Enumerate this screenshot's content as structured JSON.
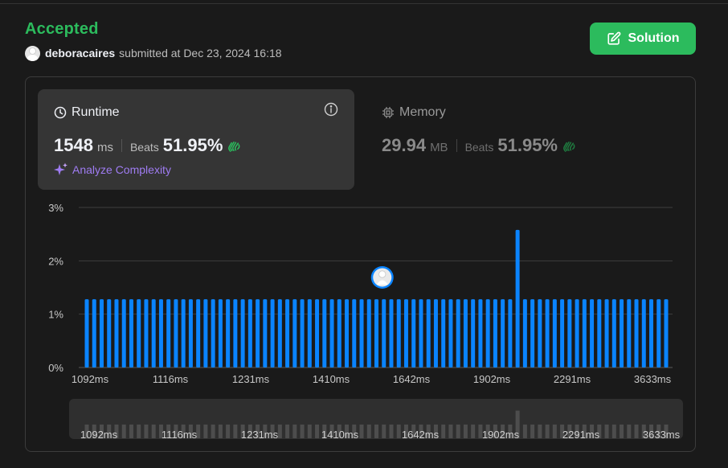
{
  "header": {
    "status": "Accepted",
    "username": "deboracaires",
    "submitted_text": "submitted at Dec 23, 2024 16:18",
    "solution_label": "Solution"
  },
  "runtime": {
    "title": "Runtime",
    "value": "1548",
    "unit": "ms",
    "beats_label": "Beats",
    "beats_pct": "51.95%",
    "analyze_label": "Analyze Complexity"
  },
  "memory": {
    "title": "Memory",
    "value": "29.94",
    "unit": "MB",
    "beats_label": "Beats",
    "beats_pct": "51.95%"
  },
  "colors": {
    "accent_green": "#2cbb5d",
    "bar_blue": "#0a84ff",
    "analyze_purple": "#9f7cf2"
  },
  "chart_data": {
    "type": "bar",
    "ylabel_ticks": [
      "3%",
      "2%",
      "1%",
      "0%"
    ],
    "ylim": [
      0,
      3
    ],
    "xtick_labels": [
      "1092ms",
      "1116ms",
      "1231ms",
      "1410ms",
      "1642ms",
      "1902ms",
      "2291ms",
      "3633ms"
    ],
    "values": [
      1.28,
      1.28,
      1.28,
      1.28,
      1.28,
      1.28,
      1.28,
      1.28,
      1.28,
      1.28,
      1.28,
      1.28,
      1.28,
      1.28,
      1.28,
      1.28,
      1.28,
      1.28,
      1.28,
      1.28,
      1.28,
      1.28,
      1.28,
      1.28,
      1.28,
      1.28,
      1.28,
      1.28,
      1.28,
      1.28,
      1.28,
      1.28,
      1.28,
      1.28,
      1.28,
      1.28,
      1.28,
      1.28,
      1.28,
      1.28,
      1.28,
      1.28,
      1.28,
      1.28,
      1.28,
      1.28,
      1.28,
      1.28,
      1.28,
      1.28,
      1.28,
      1.28,
      1.28,
      1.28,
      1.28,
      1.28,
      1.28,
      1.28,
      2.58,
      1.28,
      1.28,
      1.28,
      1.28,
      1.28,
      1.28,
      1.28,
      1.28,
      1.28,
      1.28,
      1.28,
      1.28,
      1.28,
      1.28,
      1.28,
      1.28,
      1.28,
      1.28,
      1.28,
      1.28
    ],
    "user_bar_index": 40,
    "grid": true
  }
}
